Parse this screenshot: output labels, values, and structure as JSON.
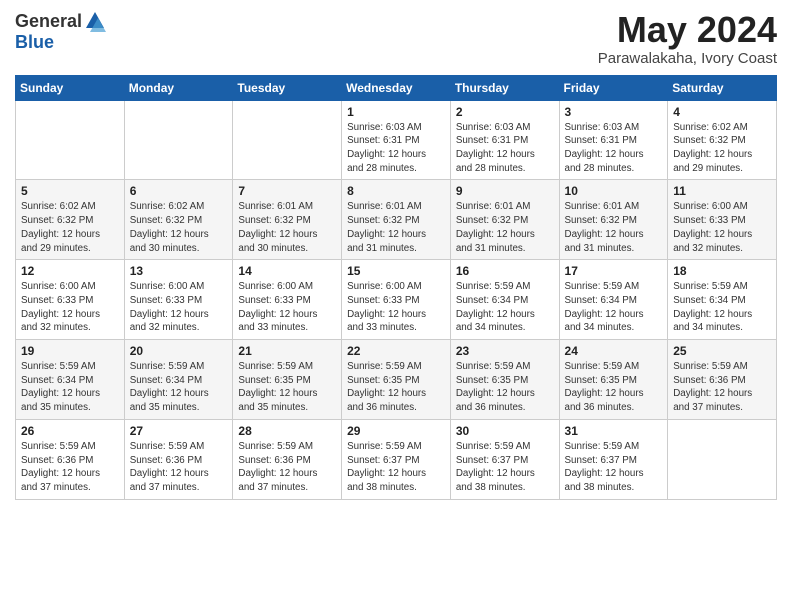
{
  "logo": {
    "general": "General",
    "blue": "Blue"
  },
  "title": {
    "month_year": "May 2024",
    "location": "Parawalakaha, Ivory Coast"
  },
  "weekdays": [
    "Sunday",
    "Monday",
    "Tuesday",
    "Wednesday",
    "Thursday",
    "Friday",
    "Saturday"
  ],
  "weeks": [
    [
      {
        "day": "",
        "info": ""
      },
      {
        "day": "",
        "info": ""
      },
      {
        "day": "",
        "info": ""
      },
      {
        "day": "1",
        "info": "Sunrise: 6:03 AM\nSunset: 6:31 PM\nDaylight: 12 hours and 28 minutes."
      },
      {
        "day": "2",
        "info": "Sunrise: 6:03 AM\nSunset: 6:31 PM\nDaylight: 12 hours and 28 minutes."
      },
      {
        "day": "3",
        "info": "Sunrise: 6:03 AM\nSunset: 6:31 PM\nDaylight: 12 hours and 28 minutes."
      },
      {
        "day": "4",
        "info": "Sunrise: 6:02 AM\nSunset: 6:32 PM\nDaylight: 12 hours and 29 minutes."
      }
    ],
    [
      {
        "day": "5",
        "info": "Sunrise: 6:02 AM\nSunset: 6:32 PM\nDaylight: 12 hours and 29 minutes."
      },
      {
        "day": "6",
        "info": "Sunrise: 6:02 AM\nSunset: 6:32 PM\nDaylight: 12 hours and 30 minutes."
      },
      {
        "day": "7",
        "info": "Sunrise: 6:01 AM\nSunset: 6:32 PM\nDaylight: 12 hours and 30 minutes."
      },
      {
        "day": "8",
        "info": "Sunrise: 6:01 AM\nSunset: 6:32 PM\nDaylight: 12 hours and 31 minutes."
      },
      {
        "day": "9",
        "info": "Sunrise: 6:01 AM\nSunset: 6:32 PM\nDaylight: 12 hours and 31 minutes."
      },
      {
        "day": "10",
        "info": "Sunrise: 6:01 AM\nSunset: 6:32 PM\nDaylight: 12 hours and 31 minutes."
      },
      {
        "day": "11",
        "info": "Sunrise: 6:00 AM\nSunset: 6:33 PM\nDaylight: 12 hours and 32 minutes."
      }
    ],
    [
      {
        "day": "12",
        "info": "Sunrise: 6:00 AM\nSunset: 6:33 PM\nDaylight: 12 hours and 32 minutes."
      },
      {
        "day": "13",
        "info": "Sunrise: 6:00 AM\nSunset: 6:33 PM\nDaylight: 12 hours and 32 minutes."
      },
      {
        "day": "14",
        "info": "Sunrise: 6:00 AM\nSunset: 6:33 PM\nDaylight: 12 hours and 33 minutes."
      },
      {
        "day": "15",
        "info": "Sunrise: 6:00 AM\nSunset: 6:33 PM\nDaylight: 12 hours and 33 minutes."
      },
      {
        "day": "16",
        "info": "Sunrise: 5:59 AM\nSunset: 6:34 PM\nDaylight: 12 hours and 34 minutes."
      },
      {
        "day": "17",
        "info": "Sunrise: 5:59 AM\nSunset: 6:34 PM\nDaylight: 12 hours and 34 minutes."
      },
      {
        "day": "18",
        "info": "Sunrise: 5:59 AM\nSunset: 6:34 PM\nDaylight: 12 hours and 34 minutes."
      }
    ],
    [
      {
        "day": "19",
        "info": "Sunrise: 5:59 AM\nSunset: 6:34 PM\nDaylight: 12 hours and 35 minutes."
      },
      {
        "day": "20",
        "info": "Sunrise: 5:59 AM\nSunset: 6:34 PM\nDaylight: 12 hours and 35 minutes."
      },
      {
        "day": "21",
        "info": "Sunrise: 5:59 AM\nSunset: 6:35 PM\nDaylight: 12 hours and 35 minutes."
      },
      {
        "day": "22",
        "info": "Sunrise: 5:59 AM\nSunset: 6:35 PM\nDaylight: 12 hours and 36 minutes."
      },
      {
        "day": "23",
        "info": "Sunrise: 5:59 AM\nSunset: 6:35 PM\nDaylight: 12 hours and 36 minutes."
      },
      {
        "day": "24",
        "info": "Sunrise: 5:59 AM\nSunset: 6:35 PM\nDaylight: 12 hours and 36 minutes."
      },
      {
        "day": "25",
        "info": "Sunrise: 5:59 AM\nSunset: 6:36 PM\nDaylight: 12 hours and 37 minutes."
      }
    ],
    [
      {
        "day": "26",
        "info": "Sunrise: 5:59 AM\nSunset: 6:36 PM\nDaylight: 12 hours and 37 minutes."
      },
      {
        "day": "27",
        "info": "Sunrise: 5:59 AM\nSunset: 6:36 PM\nDaylight: 12 hours and 37 minutes."
      },
      {
        "day": "28",
        "info": "Sunrise: 5:59 AM\nSunset: 6:36 PM\nDaylight: 12 hours and 37 minutes."
      },
      {
        "day": "29",
        "info": "Sunrise: 5:59 AM\nSunset: 6:37 PM\nDaylight: 12 hours and 38 minutes."
      },
      {
        "day": "30",
        "info": "Sunrise: 5:59 AM\nSunset: 6:37 PM\nDaylight: 12 hours and 38 minutes."
      },
      {
        "day": "31",
        "info": "Sunrise: 5:59 AM\nSunset: 6:37 PM\nDaylight: 12 hours and 38 minutes."
      },
      {
        "day": "",
        "info": ""
      }
    ]
  ]
}
